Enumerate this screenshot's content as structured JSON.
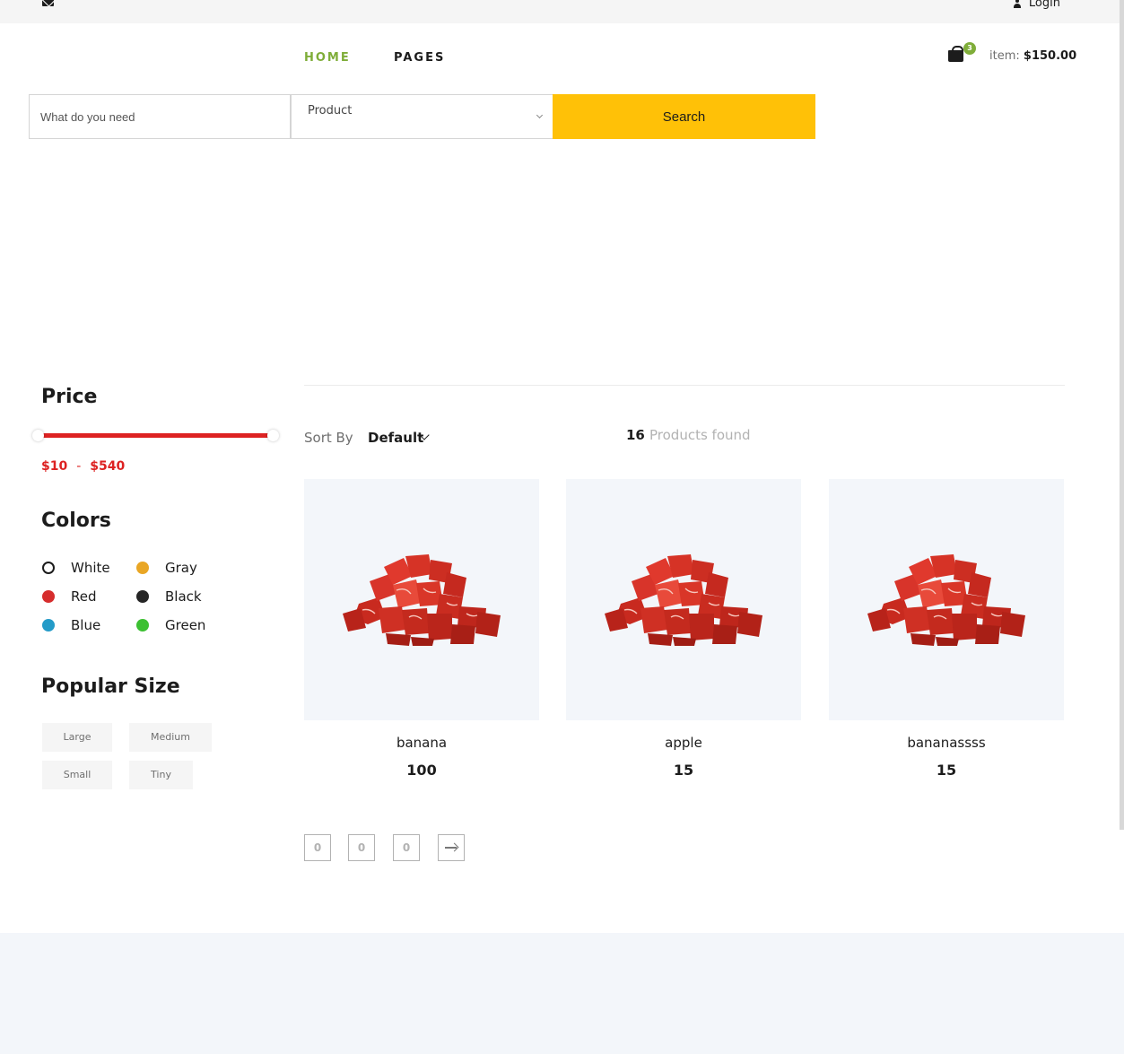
{
  "header": {
    "login_label": "Login",
    "nav": {
      "home": "HOME",
      "pages": "PAGES"
    },
    "cart": {
      "badge": "3",
      "item_prefix": "item:",
      "total": "$150.00"
    }
  },
  "search": {
    "placeholder": "What do you need",
    "category": "Product",
    "button": "Search"
  },
  "sidebar": {
    "price": {
      "title": "Price",
      "min": "$10",
      "separator": "-",
      "max": "$540",
      "range_fill_fraction": 1.0
    },
    "colors": {
      "title": "Colors",
      "items": [
        {
          "label": "White",
          "color": "#ffffff"
        },
        {
          "label": "Gray",
          "color": "#e9a625"
        },
        {
          "label": "Red",
          "color": "#d62d2d"
        },
        {
          "label": "Black",
          "color": "#252525"
        },
        {
          "label": "Blue",
          "color": "#249bc8"
        },
        {
          "label": "Green",
          "color": "#3cc032"
        }
      ]
    },
    "sizes": {
      "title": "Popular Size",
      "items": [
        "Large",
        "Medium",
        "Small",
        "Tiny"
      ]
    }
  },
  "listing": {
    "sort_label": "Sort By",
    "sort_value": "Default",
    "found_count": "16",
    "found_label": "Products found",
    "products": [
      {
        "name": "banana",
        "price": "100"
      },
      {
        "name": "apple",
        "price": "15"
      },
      {
        "name": "bananassss",
        "price": "15"
      }
    ],
    "pagination": [
      "0",
      "0",
      "0"
    ]
  },
  "colors": {
    "accent": "#7fad39",
    "search_button": "#ffc107",
    "price": "#dd2222"
  }
}
